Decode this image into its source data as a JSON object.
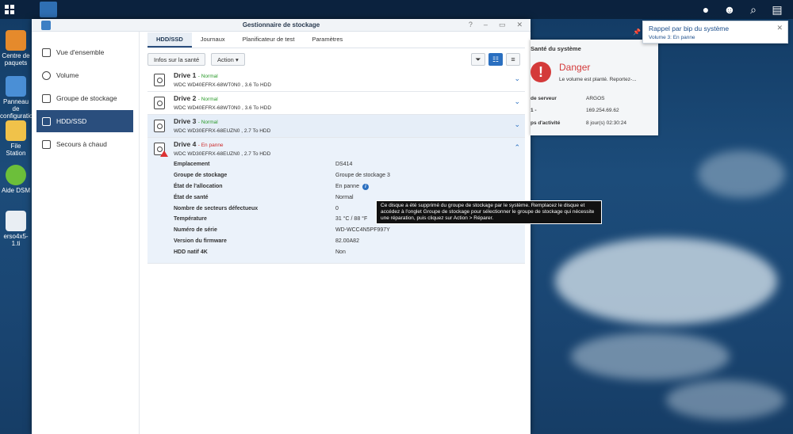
{
  "desktop": {
    "icons": [
      {
        "label": "Centre de paquets"
      },
      {
        "label": "Panneau de configuration"
      },
      {
        "label": "File Station"
      },
      {
        "label": "Aide DSM"
      },
      {
        "label": "erso4x5-1.ti"
      }
    ]
  },
  "window": {
    "title": "Gestionnaire de stockage",
    "controls": {
      "help": "?",
      "minimize": "–",
      "maximize": "▭",
      "close": "✕"
    }
  },
  "sidebar": {
    "items": [
      {
        "label": "Vue d'ensemble"
      },
      {
        "label": "Volume"
      },
      {
        "label": "Groupe de stockage"
      },
      {
        "label": "HDD/SSD"
      },
      {
        "label": "Secours à chaud"
      }
    ],
    "active": "HDD/SSD"
  },
  "tabs": [
    {
      "label": "HDD/SSD"
    },
    {
      "label": "Journaux"
    },
    {
      "label": "Planificateur de test"
    },
    {
      "label": "Paramètres"
    }
  ],
  "toolbar": {
    "health_info": "Infos sur la santé",
    "action": "Action",
    "action_arrow": "▾"
  },
  "drives": [
    {
      "name": "Drive 1",
      "status": "Normal",
      "status_color": "#2b9a2b",
      "model": "WDC WD40EFRX-68WT0N0 , 3.6 To HDD"
    },
    {
      "name": "Drive 2",
      "status": "Normal",
      "status_color": "#2b9a2b",
      "model": "WDC WD40EFRX-68WT0N0 , 3.6 To HDD"
    },
    {
      "name": "Drive 3",
      "status": "Normal",
      "status_color": "#2b9a2b",
      "model": "WDC WD30EFRX-68EUZN0 , 2.7 To HDD"
    },
    {
      "name": "Drive 4",
      "status": "En panne",
      "status_color": "#cc2a2a",
      "model": "WDC WD30EFRX-68EUZN0 , 2.7 To HDD"
    }
  ],
  "drive4_details": [
    {
      "label": "Emplacement",
      "value": "DS414"
    },
    {
      "label": "Groupe de stockage",
      "value": "Groupe de stockage 3"
    },
    {
      "label": "État de l'allocation",
      "value": "En panne"
    },
    {
      "label": "État de santé",
      "value": "Normal"
    },
    {
      "label": "Nombre de secteurs défectueux",
      "value": "0"
    },
    {
      "label": "Température",
      "value": "31 °C / 88 °F"
    },
    {
      "label": "Numéro de série",
      "value": "WD-WCC4N5PF997Y"
    },
    {
      "label": "Version du firmware",
      "value": "82.00A82"
    },
    {
      "label": "HDD natif 4K",
      "value": "Non"
    }
  ],
  "tooltip": "Ce disque a été supprimé du groupe de stockage par le système. Remplacez le disque et accédez à l'onglet Groupe de stockage pour sélectionner le groupe de stockage qui nécessite une réparation, puis cliquez sur Action > Réparer.",
  "health_widget": {
    "title": "Santé du système",
    "status": "Danger",
    "desc": "Le volume est planté. Reportez-...",
    "rows": [
      {
        "key": "de serveur",
        "value": "ARGOS"
      },
      {
        "key": "1 -",
        "value": "169.254.69.62"
      },
      {
        "key": "ps d'activité",
        "value": "8 jour(s) 02:30:24"
      }
    ]
  },
  "notification": {
    "title": "Rappel par bip du système",
    "detail": "Volume 3: En panne",
    "close": "✕"
  },
  "colors": {
    "accent": "#2a4e7d",
    "danger": "#d43a3a",
    "ok": "#2b9a2b"
  }
}
